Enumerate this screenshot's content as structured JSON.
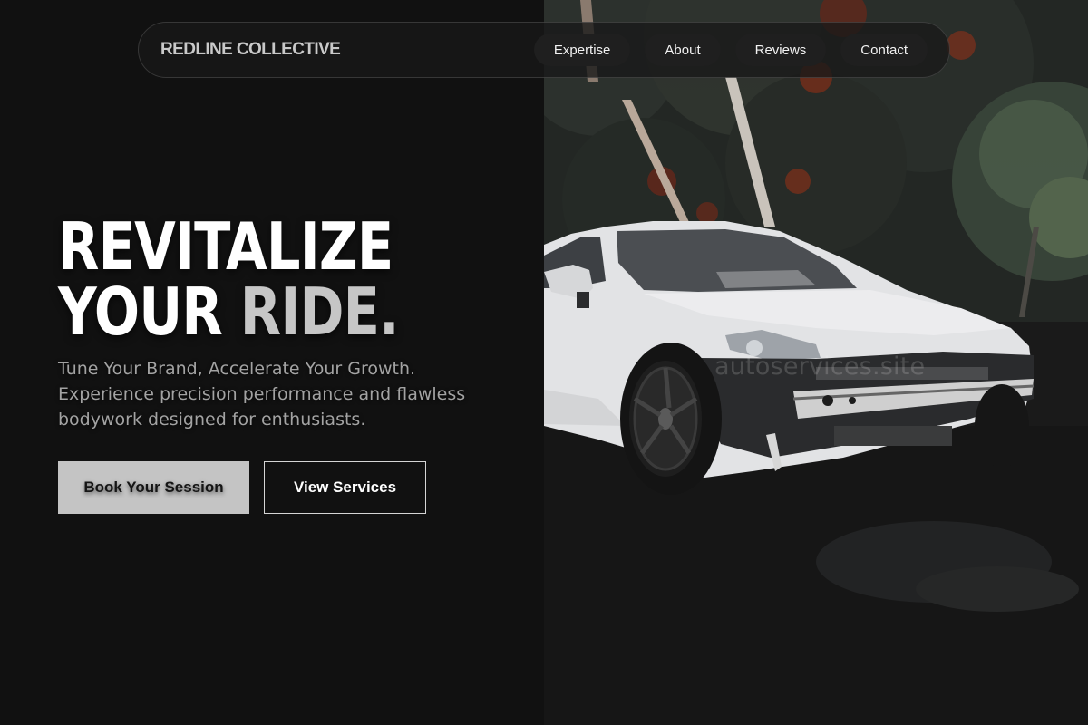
{
  "nav": {
    "brand": "REDLINE COLLECTIVE",
    "links": [
      {
        "label": "Expertise"
      },
      {
        "label": "About"
      },
      {
        "label": "Reviews"
      },
      {
        "label": "Contact"
      }
    ]
  },
  "hero": {
    "line1": "REVITALIZE",
    "line2_main": "YOUR ",
    "line2_accent": "RIDE.",
    "subtitle": "Tune Your Brand, Accelerate Your Growth. Experience precision performance and flawless bodywork designed for enthusiasts.",
    "primary_cta": "Book Your Session",
    "secondary_cta": "View Services"
  },
  "photo": {
    "watermark": "autoservices.site",
    "subject": "white-sports-car-damaged-front"
  },
  "colors": {
    "background": "#111111",
    "accent_text": "#c6c6c6",
    "primary_button": "#c4c4c4",
    "car_body": "#e2e3e5"
  }
}
